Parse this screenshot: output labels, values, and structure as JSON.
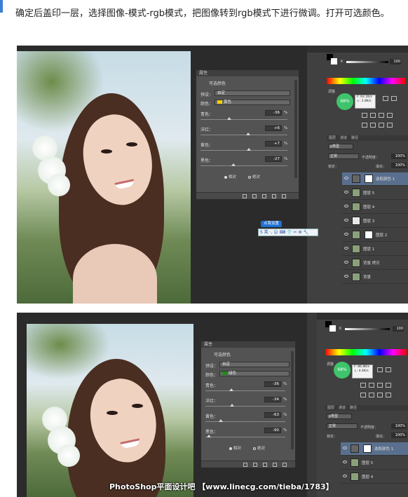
{
  "caption": "确定后盖印一层，选择图像-模式-rgb模式，把图像转到rgb模式下进行微调。打开可选颜色。",
  "screens": [
    {
      "panel": {
        "tab_title": "属性",
        "panel_name": "可选颜色",
        "preset_label": "预设：",
        "preset_value": "自定",
        "colors_label": "颜色：",
        "colors_value": "黄色",
        "swatch_color": "#f0d000",
        "sliders": [
          {
            "label": "青色：",
            "value": "-36",
            "unit": "%"
          },
          {
            "label": "洋红：",
            "value": "+6",
            "unit": "%"
          },
          {
            "label": "黄色：",
            "value": "+7",
            "unit": "%"
          },
          {
            "label": "黑色：",
            "value": "-27",
            "unit": "%"
          }
        ],
        "radio_relative": "相对",
        "radio_absolute": "绝对"
      },
      "side": {
        "k_letter": "K",
        "k_value": "100",
        "panel_adjust_label": "调整",
        "circle_value": "68%",
        "rgb_info_1": "F: 62.2K/s",
        "rgb_info_2": "↓: 2.8K/s",
        "layer_tabs": [
          "图层",
          "通道",
          "路径"
        ],
        "kind_label": "ρ类型",
        "blend_mode": "正常",
        "opacity_label": "不透明度：",
        "opacity_value": "100%",
        "lock_label": "锁定：",
        "fill_label": "填充：",
        "fill_value": "100%",
        "layers": [
          {
            "name": "选取颜色 1",
            "active": true
          },
          {
            "name": "图层 5",
            "active": false
          },
          {
            "name": "图层 4",
            "active": false
          },
          {
            "name": "图层 3",
            "active": false
          },
          {
            "name": "图层 2",
            "active": false
          },
          {
            "name": "图层 1",
            "active": false
          },
          {
            "name": "背景 拷贝",
            "active": false
          },
          {
            "name": "背景",
            "active": false
          }
        ]
      },
      "tooltip": "点我设置",
      "ime_bar": "S 英 ·, ☺ ⌨ 👕 ✂ ⚙ 🔧"
    },
    {
      "panel": {
        "tab_title": "属性",
        "panel_name": "可选颜色",
        "preset_label": "预设：",
        "preset_value": "自定",
        "colors_label": "颜色：",
        "colors_value": "绿色",
        "swatch_color": "#1e8a1e",
        "sliders": [
          {
            "label": "青色：",
            "value": "-36",
            "unit": "%"
          },
          {
            "label": "洋红：",
            "value": "-34",
            "unit": "%"
          },
          {
            "label": "黄色：",
            "value": "-63",
            "unit": "%"
          },
          {
            "label": "黑色：",
            "value": "-90",
            "unit": "%"
          }
        ],
        "radio_relative": "相对",
        "radio_absolute": "绝对"
      },
      "side": {
        "k_letter": "K",
        "k_value": "100",
        "panel_adjust_label": "调整",
        "circle_value": "68%",
        "rgb_info_1": "F: 86.8K/s",
        "rgb_info_2": "↓: 4.4K/s",
        "layer_tabs": [
          "图层",
          "通道",
          "路径"
        ],
        "kind_label": "ρ类型",
        "blend_mode": "正常",
        "opacity_label": "不透明度：",
        "opacity_value": "100%",
        "lock_label": "锁定：",
        "fill_label": "填充：",
        "fill_value": "100%",
        "layers": [
          {
            "name": "选取颜色 1",
            "active": true
          },
          {
            "name": "图层 5",
            "active": false
          },
          {
            "name": "图层 4",
            "active": false
          }
        ]
      }
    }
  ],
  "watermark": "PhotoShop平面设计吧 【www.linecg.com/tieba/1783】"
}
